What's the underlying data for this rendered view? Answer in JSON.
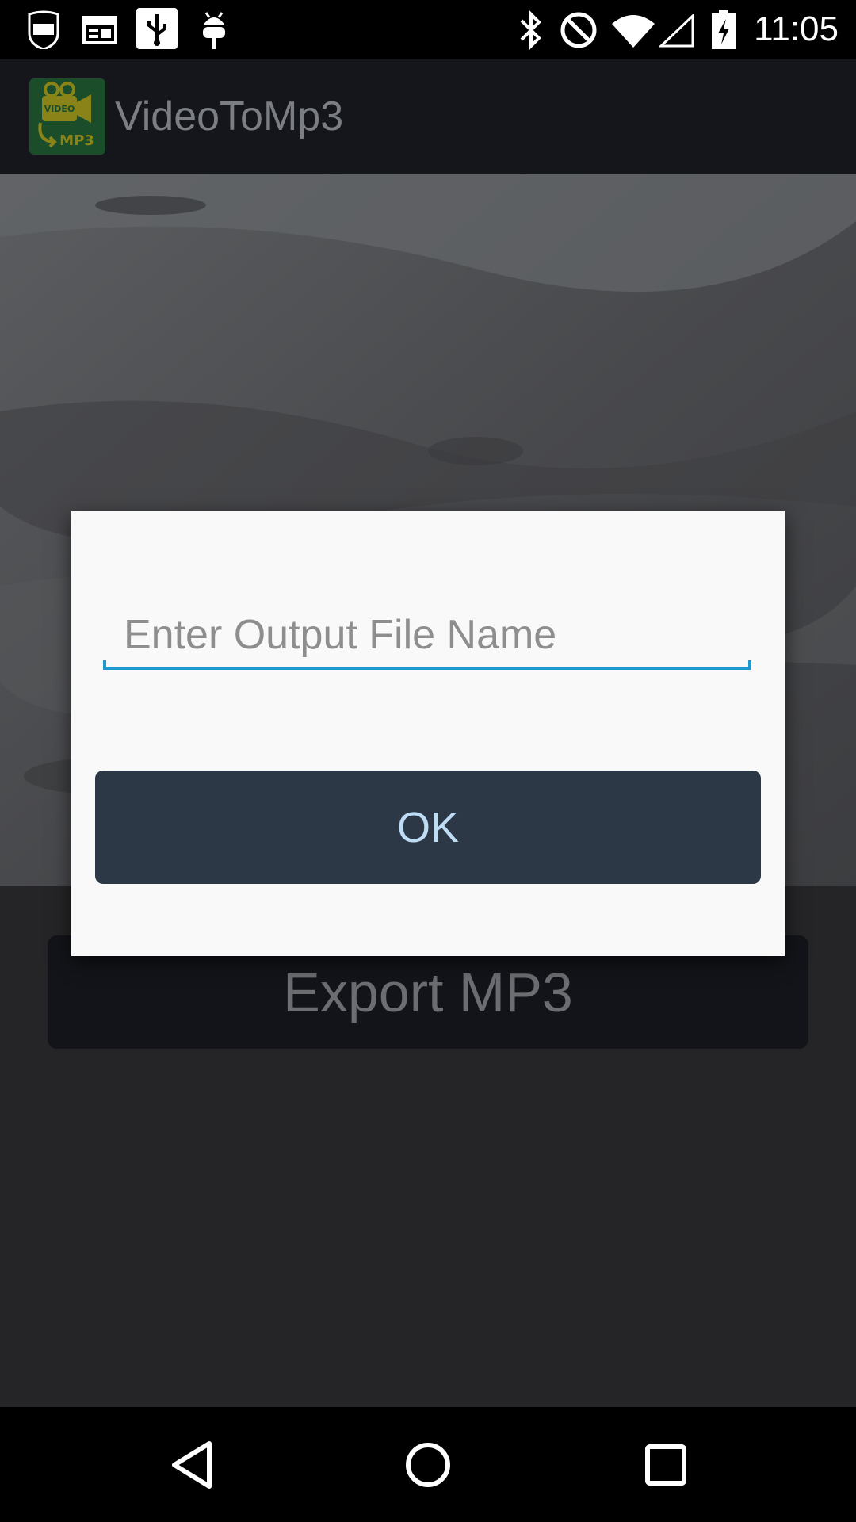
{
  "status_bar": {
    "time": "11:05",
    "left_icons": [
      "nfl-icon",
      "news-icon",
      "usb-icon",
      "android-debug-icon"
    ],
    "right_icons": [
      "bluetooth-icon",
      "do-not-disturb-icon",
      "wifi-icon",
      "signal-icon",
      "battery-charging-icon"
    ]
  },
  "app_bar": {
    "title": "VideoToMp3",
    "logo_text_top": "VIDEO",
    "logo_text_bottom": "MP3"
  },
  "main": {
    "export_button_label": "Export MP3"
  },
  "dialog": {
    "input_value": "",
    "input_placeholder": "Enter Output File Name",
    "ok_label": "OK"
  },
  "nav_bar": {
    "buttons": [
      "back-icon",
      "home-icon",
      "recents-icon"
    ]
  },
  "colors": {
    "accent": "#1c9ad0",
    "button_dark": "#2c3846",
    "ok_text": "#bfdcf5"
  }
}
